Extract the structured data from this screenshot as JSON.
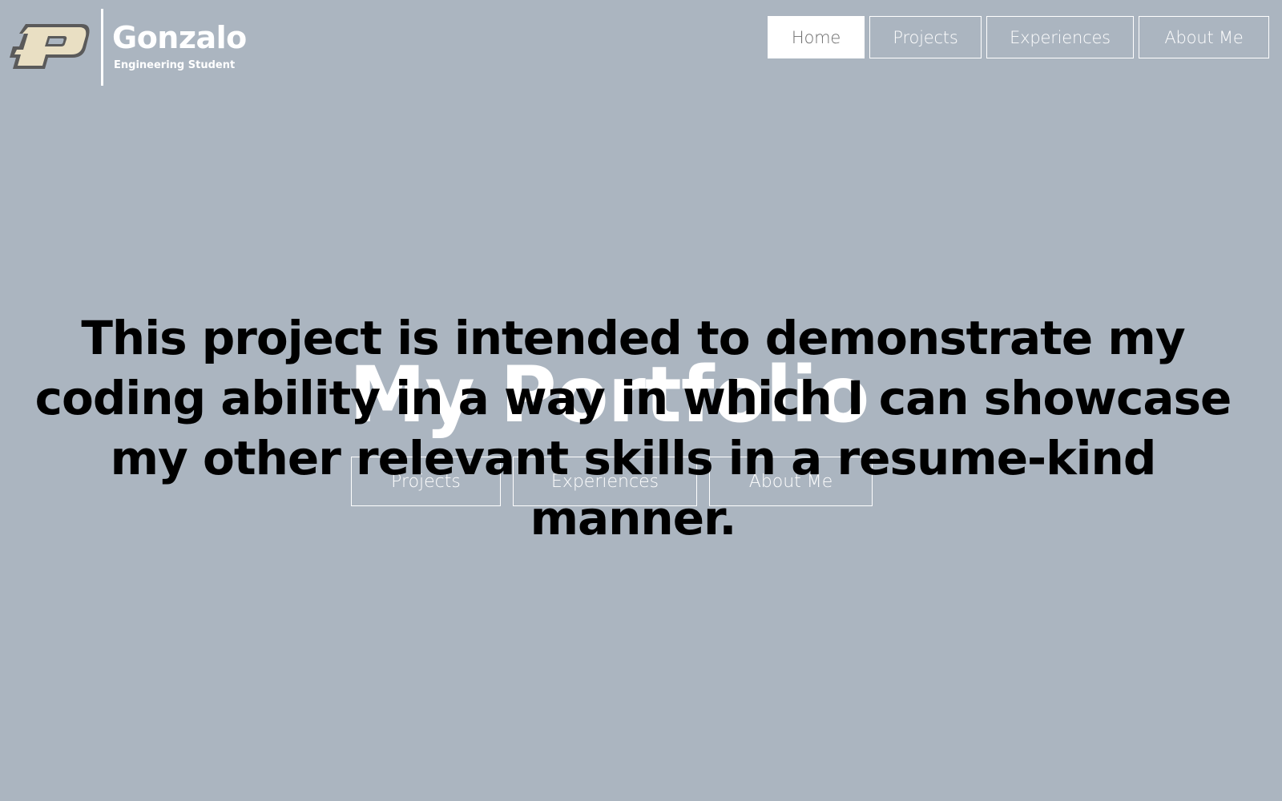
{
  "brand": {
    "logo_icon": "purdue-p-logo",
    "name": "Gonzalo",
    "subtitle": "Engineering Student"
  },
  "topnav": {
    "items": [
      {
        "label": "Home",
        "active": true
      },
      {
        "label": "Projects",
        "active": false
      },
      {
        "label": "Experiences",
        "active": false
      },
      {
        "label": "About Me",
        "active": false
      }
    ]
  },
  "hero": {
    "title": "My Portfolio",
    "buttons": [
      {
        "label": "Projects"
      },
      {
        "label": "Experiences"
      },
      {
        "label": "About Me"
      }
    ]
  },
  "statement": {
    "text": "This project is intended to demonstrate my coding ability in a way in which I can showcase my other relevant skills in a resume-kind manner."
  },
  "colors": {
    "background": "#abb5c0",
    "logo_gold": "#e9dfc3",
    "logo_outline": "#5a5a5a",
    "text_light": "#ffffff",
    "statement_text": "#000000"
  }
}
